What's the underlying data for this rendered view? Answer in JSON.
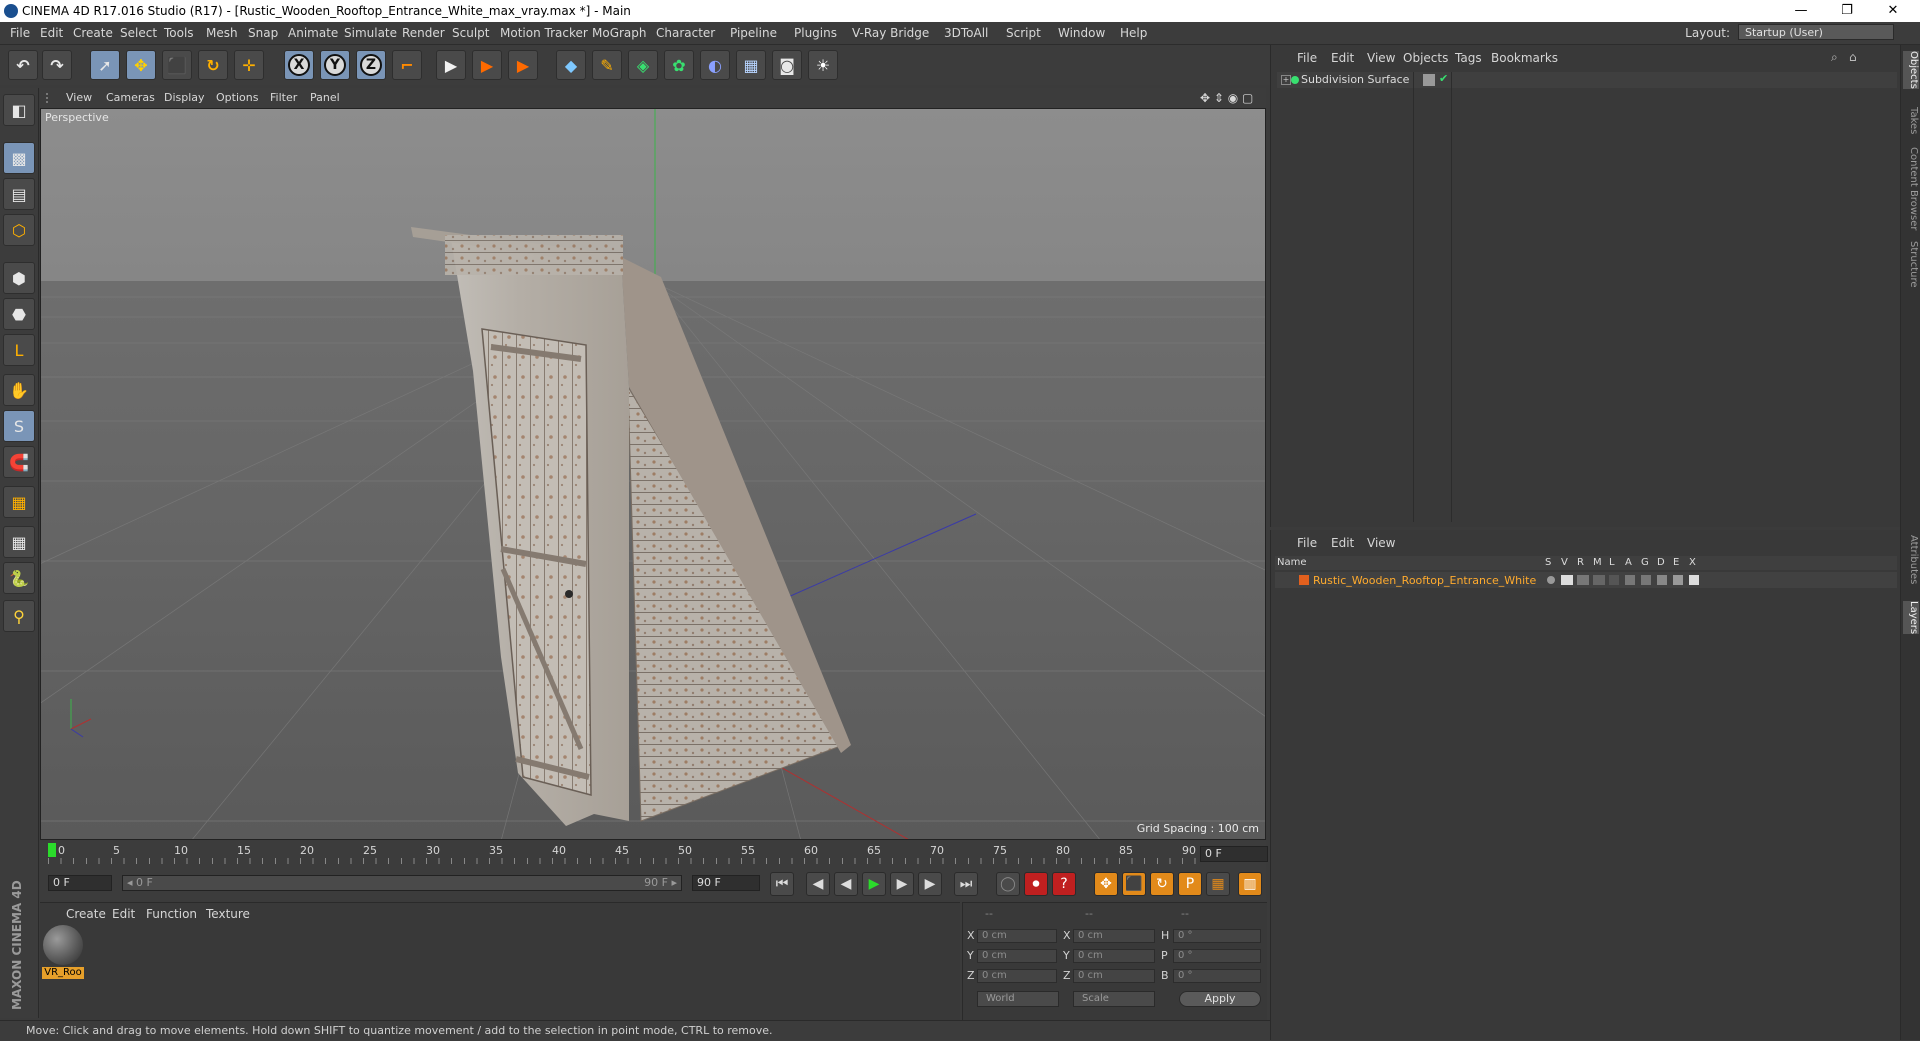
{
  "window": {
    "title": "CINEMA 4D R17.016 Studio (R17) - [Rustic_Wooden_Rooftop_Entrance_White_max_vray.max *] - Main",
    "minimize": "—",
    "restore": "❐",
    "close": "✕"
  },
  "menubar": {
    "items": [
      "File",
      "Edit",
      "Create",
      "Select",
      "Tools",
      "Mesh",
      "Snap",
      "Animate",
      "Simulate",
      "Render",
      "Sculpt",
      "Motion Tracker",
      "MoGraph",
      "Character",
      "Pipeline",
      "Plugins",
      "V-Ray Bridge",
      "3DToAll",
      "Script",
      "Window",
      "Help"
    ],
    "layout_label": "Layout:",
    "layout_value": "Startup (User)"
  },
  "toolbar": {
    "undo": "↶",
    "redo": "↷",
    "select": "➚",
    "move": "✥",
    "scale": "⬛",
    "rotate": "↻",
    "transform": "✛",
    "axis_x": "X",
    "axis_y": "Y",
    "axis_z": "Z",
    "coord": "⌐",
    "render_view": "▶",
    "render_pic": "▶",
    "render_settings": "▶",
    "cube": "◆",
    "pen": "✎",
    "subdiv": "◈",
    "array": "✿",
    "deformer": "◐",
    "floor": "▦",
    "camera": "◙",
    "light": "☀"
  },
  "left_toolbar": [
    "◧",
    "▩",
    "▤",
    "⬡",
    "⬢",
    "⬣",
    "L",
    "✋",
    "S",
    "🧲",
    "▦",
    "▦",
    "🐍"
  ],
  "brand": "MAXON CINEMA 4D",
  "viewport": {
    "menu": [
      "View",
      "Cameras",
      "Display",
      "Options",
      "Filter",
      "Panel"
    ],
    "label": "Perspective",
    "grid_spacing": "Grid Spacing : 100 cm",
    "nav_icons": "✥ ⇕ ◉ ▢"
  },
  "timeline": {
    "ticks": [
      "0",
      "5",
      "10",
      "15",
      "20",
      "25",
      "30",
      "35",
      "40",
      "45",
      "50",
      "55",
      "60",
      "65",
      "70",
      "75",
      "80",
      "85",
      "90"
    ],
    "end_frame": "0 F",
    "current_frame": "0 F",
    "range_start": "◂ 0 F",
    "range_end": "90 F ▸",
    "max_frame": "90 F"
  },
  "transport": {
    "to_start": "⏮",
    "prev_key": "◀",
    "prev_frame": "◀",
    "play": "▶",
    "next_frame": "▶",
    "next_key": "▶",
    "to_end": "⏭",
    "rec_a": "◯",
    "rec_b": "⏺",
    "rec_c": "?",
    "k1": "✥",
    "k2": "⬛",
    "k3": "↻",
    "k4": "P",
    "k5": "▦",
    "k6": "▥"
  },
  "material_manager": {
    "menu": [
      "Create",
      "Edit",
      "Function",
      "Texture"
    ],
    "material_label": "VR_Roo"
  },
  "coordinates": {
    "col_headers": [
      "--",
      "--",
      "--"
    ],
    "rows": [
      {
        "a": "X",
        "av": "0 cm",
        "b": "X",
        "bv": "0 cm",
        "c": "H",
        "cv": "0 °"
      },
      {
        "a": "Y",
        "av": "0 cm",
        "b": "Y",
        "bv": "0 cm",
        "c": "P",
        "cv": "0 °"
      },
      {
        "a": "Z",
        "av": "0 cm",
        "b": "Z",
        "bv": "0 cm",
        "c": "B",
        "cv": "0 °"
      }
    ],
    "world": "World",
    "scale": "Scale",
    "apply": "Apply"
  },
  "status": "Move: Click and drag to move elements. Hold down SHIFT to quantize movement / add to the selection in point mode, CTRL to remove.",
  "object_manager": {
    "menu": [
      "File",
      "Edit",
      "View",
      "Objects",
      "Tags",
      "Bookmarks"
    ],
    "object": "Subdivision Surface"
  },
  "layer_manager": {
    "menu": [
      "File",
      "Edit",
      "View"
    ],
    "col_name": "Name",
    "cols": [
      "S",
      "V",
      "R",
      "M",
      "L",
      "A",
      "G",
      "D",
      "E",
      "X"
    ],
    "object": "Rustic_Wooden_Rooftop_Entrance_White"
  },
  "side_tabs": [
    "Objects",
    "Takes",
    "Content Browser",
    "Structure",
    "Attributes",
    "Layers"
  ],
  "colors": {
    "accent": "#7a95b7",
    "layer_text": "#ffab2e",
    "material_tag": "#e7a02a"
  }
}
